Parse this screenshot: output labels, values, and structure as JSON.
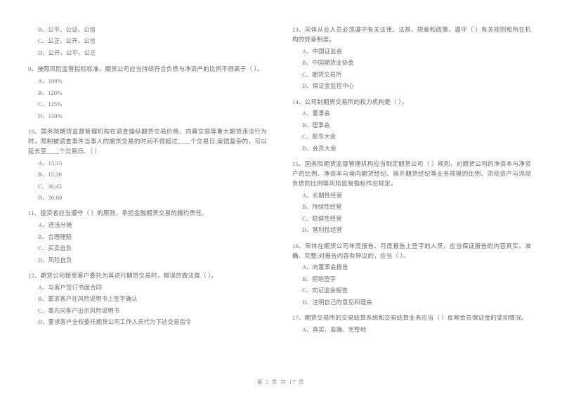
{
  "document": {
    "type": "exam-paper",
    "language": "zh-CN",
    "footer": "第 2 页 共 17 页"
  },
  "left_column": {
    "leading_options": [
      "B、公平、公证、公信",
      "C、公正、公开、公信",
      "D、公开、公平、公正"
    ],
    "questions": [
      {
        "number": "9",
        "stem": "9、按照风险监管指标标准，期货公司应当持续符合负债与净资产的比例不得高于（      ）。",
        "options": [
          "A、100%",
          "B、120%",
          "C、125%",
          "D、150%"
        ]
      },
      {
        "number": "10",
        "stem": "10、国务院期货监督管理机构在调查操纵期货交易价格、内幕交易等重大期货违法行为时，限制被调查事件当事人的期货交易的时间不得超过____个交易日;案情复杂的，可以延长至____个交易日。（      ）",
        "options": [
          "A、15;15",
          "B、15;30",
          "C、30;45",
          "D、30;60"
        ]
      },
      {
        "number": "11",
        "stem": "11、投资者应当遵守（      ）的原则，承担金融期货交易的履约责任。",
        "options": [
          "A、适当分摊",
          "B、合理理赔",
          "C、买卖自负",
          "D、风险自负"
        ]
      },
      {
        "number": "12",
        "stem": "12、期货公司接受客户委托为其进行期货交易时，错误的做法是（      ）。",
        "options": [
          "A、与客户签订书面合同",
          "B、要求客户在风险说明书上签字确认",
          "C、事先向客户出示风险说明书",
          "D、要求客户全权委托期货公司工作人员代为下达交易指令"
        ]
      }
    ]
  },
  "right_column": {
    "questions": [
      {
        "number": "13",
        "stem": "13、宋体从业人员必须遵守有关法律、法规、规章和政策，遵守（      ）有关规则和所在机构的规章制度。",
        "options": [
          "A、中国证监会",
          "B、中国期货业协会",
          "C、期货交易所",
          "D、保证金监控中心"
        ]
      },
      {
        "number": "14",
        "stem": "14、公司制期货交易所的权力机构是（      ）。",
        "options": [
          "A、董事会",
          "B、理事会",
          "C、股东大会",
          "D、会员大会"
        ]
      },
      {
        "number": "15",
        "stem": "15、国务院期货监督管理机构应当制定期货公司（      ）规则，对期货公司的净资本与净资产的比例、净资本与境内期货经纪、境外期货经纪等业务规模的比例、流动资产与流动负债的比例等风险监管指标作出规定。",
        "options": [
          "A、长期性经营",
          "B、持续性经营",
          "C、稳健性经营",
          "D、营利性经营"
        ]
      },
      {
        "number": "16",
        "stem": "16、宋体在期货公司年度报告、月度报告上签字的人员，应当保证报告的内容真实、准确、完整;对报告内容有异议的，应当（      ）。",
        "options": [
          "A、向董事会报告",
          "B、拒绝签字",
          "C、向证监会报告",
          "D、注明自己的意见和理由"
        ]
      },
      {
        "number": "17",
        "stem": "17、期货交易所的交易结算系统和交易结算业务应当（      ）反映会员保证金的变动情况。",
        "options": [
          "A、真实、准确、完整地"
        ]
      }
    ]
  }
}
